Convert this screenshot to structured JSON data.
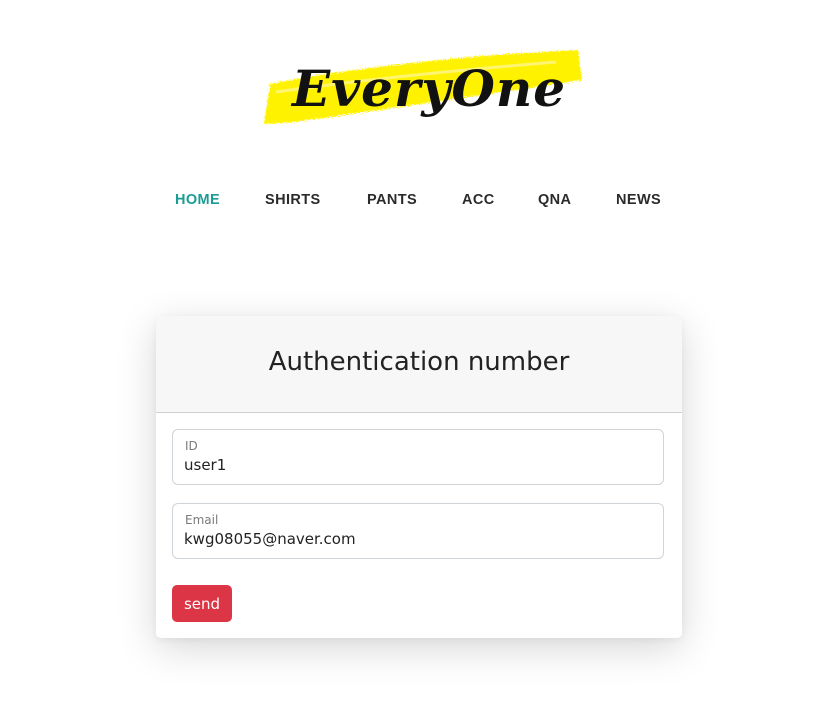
{
  "logo": {
    "text": "EveryOne",
    "highlight_color": "#fff200"
  },
  "nav": {
    "items": [
      {
        "label": "HOME",
        "active": true
      },
      {
        "label": "SHIRTS",
        "active": false
      },
      {
        "label": "PANTS",
        "active": false
      },
      {
        "label": "ACC",
        "active": false
      },
      {
        "label": "QNA",
        "active": false
      },
      {
        "label": "NEWS",
        "active": false
      }
    ],
    "active_color": "#1a9c96"
  },
  "auth_card": {
    "title": "Authentication number",
    "id_field": {
      "label": "ID",
      "value": "user1"
    },
    "email_field": {
      "label": "Email",
      "value": "kwg08055@naver.com"
    },
    "send_label": "send",
    "send_color": "#dc3545"
  }
}
